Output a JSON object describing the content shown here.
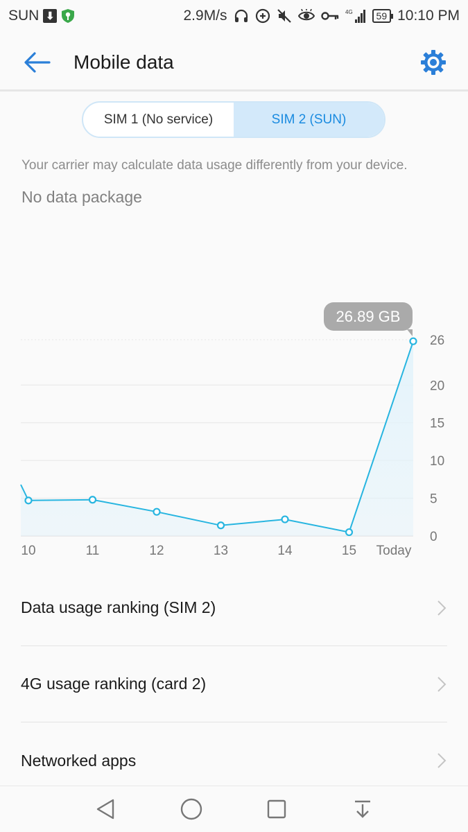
{
  "status_bar": {
    "carrier": "SUN",
    "speed": "2.9M/s",
    "network": "4G",
    "battery": "59",
    "time": "10:10 PM"
  },
  "header": {
    "title": "Mobile data"
  },
  "sim_tabs": [
    {
      "label": "SIM 1 (No service)",
      "active": false
    },
    {
      "label": "SIM 2 (SUN)",
      "active": true
    }
  ],
  "notice": "Your carrier may calculate data usage differently from your device.",
  "package_status": "No data package",
  "chart_data": {
    "type": "line",
    "categories": [
      "10",
      "11",
      "12",
      "13",
      "14",
      "15",
      "Today"
    ],
    "values": [
      4.7,
      4.8,
      3.2,
      1.4,
      2.2,
      0.5,
      25.8
    ],
    "start_value": 6.8,
    "yticks": [
      0,
      5,
      10,
      15,
      20,
      26
    ],
    "ylim": [
      0,
      26
    ],
    "highlight_label": "26.89 GB",
    "grid": true,
    "line_color": "#27b5e0",
    "fill_color": "#e3f3fb"
  },
  "list_items": [
    {
      "label": "Data usage ranking (SIM 2)"
    },
    {
      "label": "4G usage ranking (card 2)"
    },
    {
      "label": "Networked apps"
    }
  ],
  "colors": {
    "accent": "#1a8be0",
    "icon": "#2b7fd8"
  },
  "icons": {
    "back": "arrow-left-icon",
    "settings": "gear-icon",
    "chevron": "chevron-right-icon",
    "nav_back": "triangle-back-icon",
    "nav_home": "circle-home-icon",
    "nav_recents": "square-recents-icon",
    "nav_notifications": "pull-down-icon"
  }
}
